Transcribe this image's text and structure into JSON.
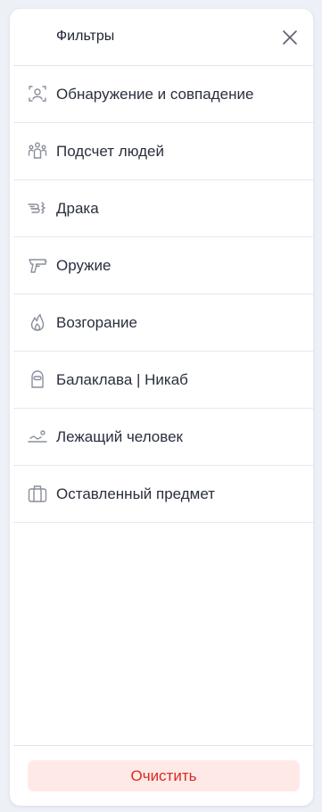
{
  "header": {
    "title": "Фильтры",
    "close_icon": "close-icon"
  },
  "filters": [
    {
      "label": "Обнаружение и совпадение",
      "icon": "face-scan-icon"
    },
    {
      "label": "Подсчет людей",
      "icon": "people-count-icon"
    },
    {
      "label": "Драка",
      "icon": "fight-icon"
    },
    {
      "label": "Оружие",
      "icon": "gun-icon"
    },
    {
      "label": "Возгорание",
      "icon": "fire-icon"
    },
    {
      "label": "Балаклава | Никаб",
      "icon": "balaclava-icon"
    },
    {
      "label": "Лежащий человек",
      "icon": "lying-person-icon"
    },
    {
      "label": "Оставленный предмет",
      "icon": "suitcase-icon"
    }
  ],
  "footer": {
    "clear_label": "Очистить"
  },
  "colors": {
    "background": "#eef0f7",
    "panel": "#ffffff",
    "text": "#2a2f3d",
    "icon": "#8a8f9c",
    "clear_bg": "#ffe9e7",
    "clear_text": "#d72c20"
  }
}
